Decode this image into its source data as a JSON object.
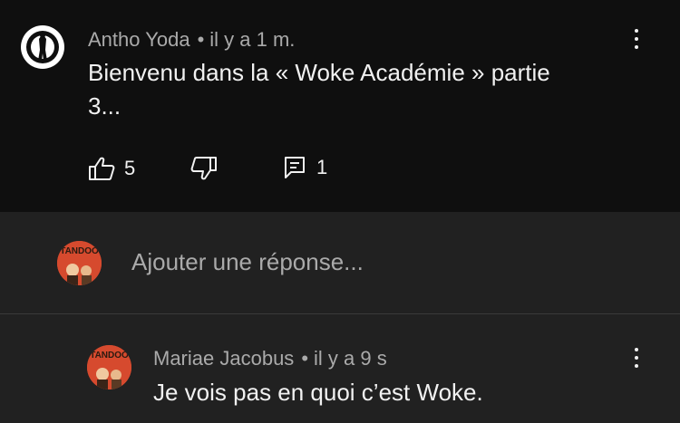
{
  "comment": {
    "author": "Antho Yoda",
    "separator": "•",
    "time": "il y a 1 m.",
    "text_line1": "Bienvenu dans la « Woke Académie » partie",
    "text_line2": "3...",
    "likes": "5",
    "replies": "1"
  },
  "reply_box": {
    "placeholder": "Ajouter une réponse...",
    "avatar_text": "TANDOO"
  },
  "reply": {
    "author": "Mariae Jacobus",
    "separator": "•",
    "time": "il y a 9 s",
    "text": "Je vois pas en quoi c’est Woke.",
    "avatar_text": "TANDOO"
  },
  "icons": {
    "like": "thumbs-up-icon",
    "dislike": "thumbs-down-icon",
    "reply": "comment-icon",
    "more": "more-vertical-icon"
  },
  "colors": {
    "background": "#0f0f0f",
    "panel": "#212121",
    "muted_text": "#aaaaaa",
    "text": "#f1f1f1",
    "avatar": "#d64a2e"
  }
}
